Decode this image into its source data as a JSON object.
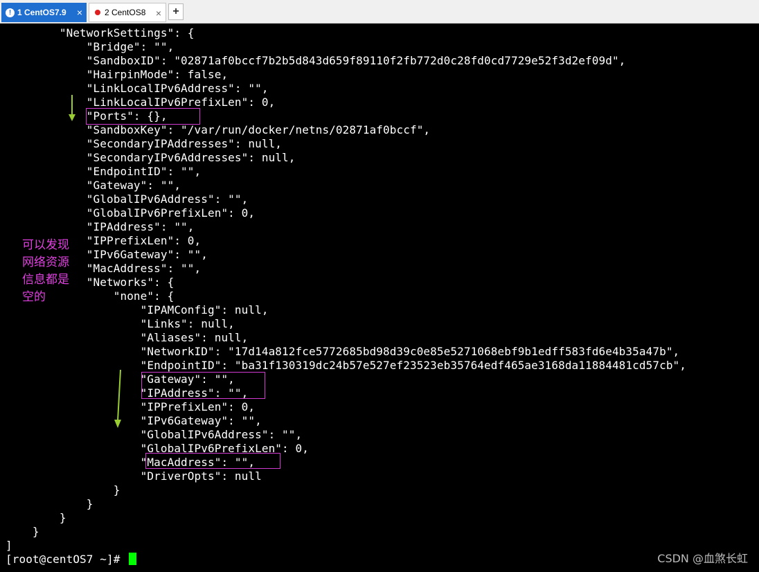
{
  "tabs": [
    {
      "label": "1 CentOS7.9",
      "active": true
    },
    {
      "label": "2 CentOS8",
      "active": false
    }
  ],
  "new_tab_label": "+",
  "terminal": {
    "lines": [
      "        \"NetworkSettings\": {",
      "            \"Bridge\": \"\",",
      "            \"SandboxID\": \"02871af0bccf7b2b5d843d659f89110f2fb772d0c28fd0cd7729e52f3d2ef09d\",",
      "            \"HairpinMode\": false,",
      "            \"LinkLocalIPv6Address\": \"\",",
      "            \"LinkLocalIPv6PrefixLen\": 0,",
      "            \"Ports\": {},",
      "            \"SandboxKey\": \"/var/run/docker/netns/02871af0bccf\",",
      "            \"SecondaryIPAddresses\": null,",
      "            \"SecondaryIPv6Addresses\": null,",
      "            \"EndpointID\": \"\",",
      "            \"Gateway\": \"\",",
      "            \"GlobalIPv6Address\": \"\",",
      "            \"GlobalIPv6PrefixLen\": 0,",
      "            \"IPAddress\": \"\",",
      "            \"IPPrefixLen\": 0,",
      "            \"IPv6Gateway\": \"\",",
      "            \"MacAddress\": \"\",",
      "            \"Networks\": {",
      "                \"none\": {",
      "                    \"IPAMConfig\": null,",
      "                    \"Links\": null,",
      "                    \"Aliases\": null,",
      "                    \"NetworkID\": \"17d14a812fce5772685bd98d39c0e85e5271068ebf9b1edff583fd6e4b35a47b\",",
      "                    \"EndpointID\": \"ba31f130319dc24b57e527ef23523eb35764edf465ae3168da11884481cd57cb\",",
      "                    \"Gateway\": \"\",",
      "                    \"IPAddress\": \"\",",
      "                    \"IPPrefixLen\": 0,",
      "                    \"IPv6Gateway\": \"\",",
      "                    \"GlobalIPv6Address\": \"\",",
      "                    \"GlobalIPv6PrefixLen\": 0,",
      "                    \"MacAddress\": \"\",",
      "                    \"DriverOpts\": null",
      "                }",
      "            }",
      "        }",
      "    }",
      "]",
      "[root@centOS7 ~]# "
    ]
  },
  "annotation": {
    "note_lines": [
      "可以发现",
      "网络资源",
      "信息都是",
      "空的"
    ],
    "note_color": "#e040e0",
    "highlight_color": "#d23ad2",
    "arrow_color": "#9acd32"
  },
  "watermark": "CSDN @血煞长虹",
  "colors": {
    "tab_active": "#1f6fd1",
    "cursor": "#00ff00",
    "terminal_bg": "#000000"
  }
}
